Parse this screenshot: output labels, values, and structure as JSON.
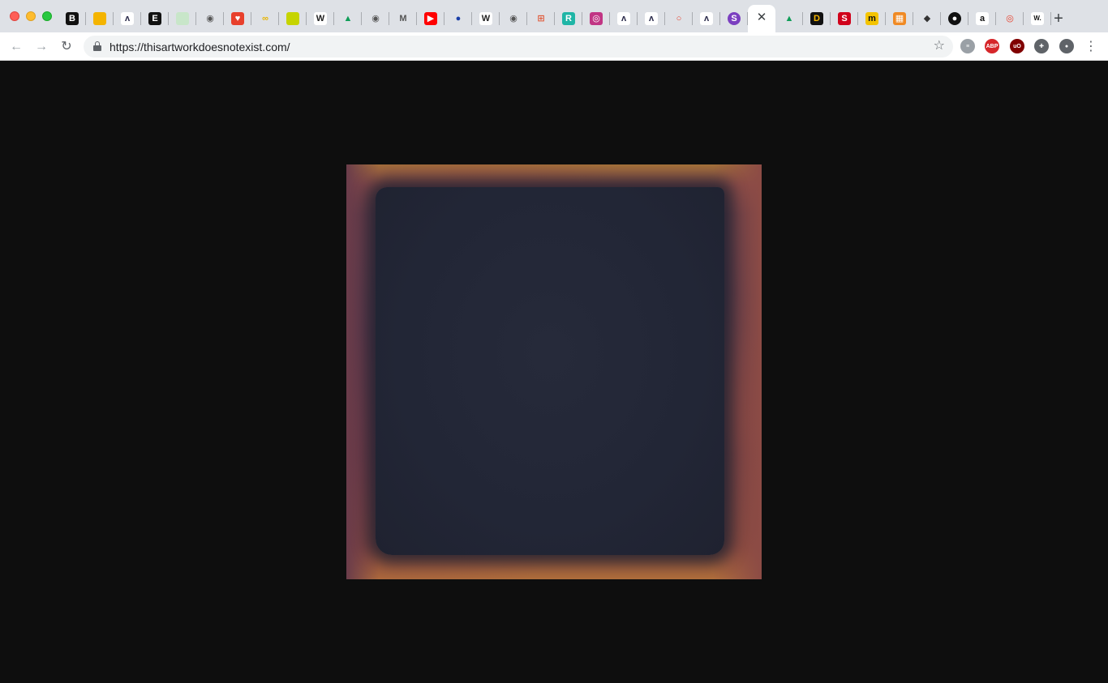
{
  "browser": {
    "tabs": [
      {
        "name": "bloglovin-icon",
        "glyph": "B",
        "bg": "#111111",
        "fg": "#ffffff"
      },
      {
        "name": "slides-icon",
        "glyph": "",
        "bg": "#f4b400",
        "fg": "#ffffff"
      },
      {
        "name": "bird-icon",
        "glyph": "ʌ",
        "bg": "#ffffff",
        "fg": "#2a2a4a"
      },
      {
        "name": "e-icon",
        "glyph": "E",
        "bg": "#111111",
        "fg": "#ffffff"
      },
      {
        "name": "sheets-icon",
        "glyph": "",
        "bg": "#c8e6c9",
        "fg": "#ffffff"
      },
      {
        "name": "globe-icon",
        "glyph": "◉",
        "bg": "#dee1e6",
        "fg": "#555555"
      },
      {
        "name": "pocket-icon",
        "glyph": "♥",
        "bg": "#e8402c",
        "fg": "#ffffff"
      },
      {
        "name": "cc-icon",
        "glyph": "∞",
        "bg": "#dee1e6",
        "fg": "#e8b400"
      },
      {
        "name": "tag-icon",
        "glyph": "",
        "bg": "#c6d400",
        "fg": "#ffffff"
      },
      {
        "name": "wikipedia-icon",
        "glyph": "W",
        "bg": "#ffffff",
        "fg": "#222222"
      },
      {
        "name": "drive-icon",
        "glyph": "▲",
        "bg": "#dee1e6",
        "fg": "#0f9d58"
      },
      {
        "name": "globe-icon",
        "glyph": "◉",
        "bg": "#dee1e6",
        "fg": "#555555"
      },
      {
        "name": "medium-icon",
        "glyph": "M",
        "bg": "#dee1e6",
        "fg": "#555555"
      },
      {
        "name": "youtube-icon",
        "glyph": "▶",
        "bg": "#ff0000",
        "fg": "#ffffff"
      },
      {
        "name": "blue-orb-icon",
        "glyph": "●",
        "bg": "#dee1e6",
        "fg": "#1a3fa8"
      },
      {
        "name": "wikipedia-icon",
        "glyph": "W",
        "bg": "#ffffff",
        "fg": "#222222"
      },
      {
        "name": "globe-icon",
        "glyph": "◉",
        "bg": "#dee1e6",
        "fg": "#555555"
      },
      {
        "name": "book-icon",
        "glyph": "⊞",
        "bg": "#dee1e6",
        "fg": "#e05a3a"
      },
      {
        "name": "r-icon",
        "glyph": "R",
        "bg": "#1fb5a6",
        "fg": "#ffffff"
      },
      {
        "name": "instagram-icon",
        "glyph": "◎",
        "bg": "#c13584",
        "fg": "#ffffff"
      },
      {
        "name": "bird-icon",
        "glyph": "ʌ",
        "bg": "#ffffff",
        "fg": "#2a2a4a"
      },
      {
        "name": "bird-icon",
        "glyph": "ʌ",
        "bg": "#ffffff",
        "fg": "#2a2a4a"
      },
      {
        "name": "drop-icon",
        "glyph": "○",
        "bg": "#dee1e6",
        "fg": "#e8402c"
      },
      {
        "name": "bird-icon",
        "glyph": "ʌ",
        "bg": "#ffffff",
        "fg": "#2a2a4a"
      },
      {
        "name": "s-circle-icon",
        "glyph": "S",
        "bg": "#7b3fc0",
        "fg": "#ffffff",
        "round": true
      },
      {
        "name": "close-icon",
        "glyph": "✕",
        "active": true
      },
      {
        "name": "drive-icon",
        "glyph": "▲",
        "bg": "#dee1e6",
        "fg": "#0f9d58"
      },
      {
        "name": "d-icon",
        "glyph": "D",
        "bg": "#111111",
        "fg": "#f4b400"
      },
      {
        "name": "s-icon",
        "glyph": "S",
        "bg": "#d0021b",
        "fg": "#ffffff"
      },
      {
        "name": "m-icon",
        "glyph": "m",
        "bg": "#f4c400",
        "fg": "#111111"
      },
      {
        "name": "grid-icon",
        "glyph": "▦",
        "bg": "#f08a24",
        "fg": "#ffffff"
      },
      {
        "name": "diamond-icon",
        "glyph": "◆",
        "bg": "#dee1e6",
        "fg": "#333333"
      },
      {
        "name": "black-circle-icon",
        "glyph": "●",
        "bg": "#111111",
        "fg": "#ffffff",
        "round": true
      },
      {
        "name": "amazon-icon",
        "glyph": "a",
        "bg": "#ffffff",
        "fg": "#111111"
      },
      {
        "name": "target-icon",
        "glyph": "◎",
        "bg": "#dee1e6",
        "fg": "#e8402c"
      },
      {
        "name": "w-dot-icon",
        "glyph": "W.",
        "bg": "#ffffff",
        "fg": "#111111"
      }
    ],
    "new_tab_label": "+",
    "url": "https://thisartworkdoesnotexist.com/",
    "extensions": [
      {
        "name": "database-extension-icon",
        "glyph": "≡",
        "bg": "#9aa0a6"
      },
      {
        "name": "adblock-plus-icon",
        "glyph": "ABP",
        "bg": "#d6262a"
      },
      {
        "name": "ublock-origin-icon",
        "glyph": "uO",
        "bg": "#800000"
      },
      {
        "name": "extensions-puzzle-icon",
        "glyph": "✚",
        "bg": "#5f6368"
      },
      {
        "name": "profile-icon",
        "glyph": "●",
        "bg": "#5f6368"
      }
    ],
    "menu_glyph": "⋮"
  },
  "colors": {
    "tabstrip": "#dee1e6",
    "toolbar": "#ffffff",
    "page_bg": "#0e0e0e"
  }
}
